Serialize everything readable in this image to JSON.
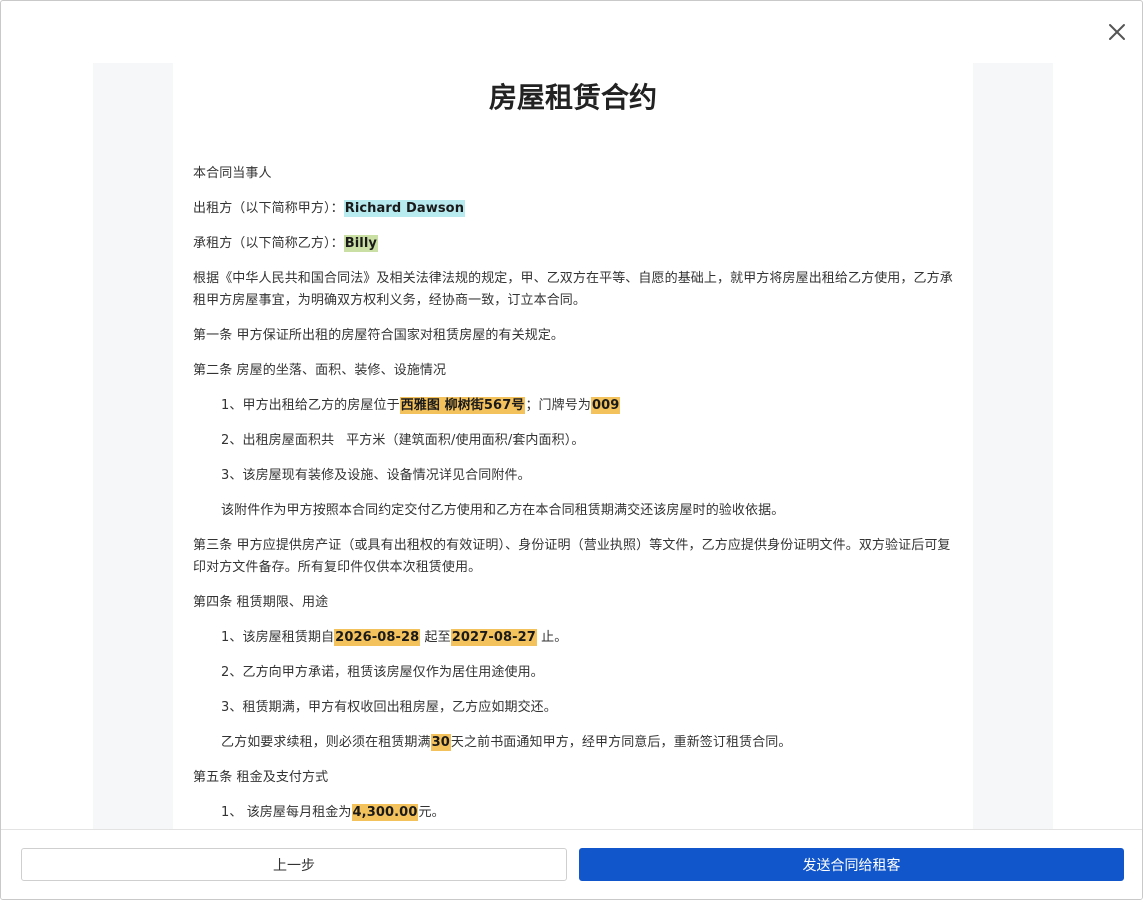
{
  "colors": {
    "primary": "#1256cc",
    "highlight_landlord": "#b8ebf0",
    "highlight_tenant": "#c9dfa3",
    "highlight_field": "#f4c25c",
    "doc_background": "#f6f7f9"
  },
  "icons": {
    "close": "close-icon"
  },
  "document": {
    "title": "房屋租赁合约",
    "parties_heading": "本合同当事人",
    "landlord_label": "出租方（以下简称甲方）：",
    "landlord_name": "Richard Dawson",
    "tenant_label": "承租方（以下简称乙方）：",
    "tenant_name": "Billy",
    "preamble": "根据《中华人民共和国合同法》及相关法律法规的规定，甲、乙双方在平等、自愿的基础上，就甲方将房屋出租给乙方使用，乙方承租甲方房屋事宜，为明确双方权利义务，经协商一致，订立本合同。",
    "article1": "第一条 甲方保证所出租的房屋符合国家对租赁房屋的有关规定。",
    "article2": {
      "heading": "第二条 房屋的坐落、面积、装修、设施情况",
      "item1_prefix": "1、甲方出租给乙方的房屋位于",
      "address": "西雅图 柳树街567号",
      "item1_mid": "；门牌号为",
      "door_number": "009",
      "item2_prefix": "2、出租房屋面积共",
      "item2_suffix": "平方米（建筑面积/使用面积/套内面积）。",
      "item3": "3、该房屋现有装修及设施、设备情况详见合同附件。",
      "note": "该附件作为甲方按照本合同约定交付乙方使用和乙方在本合同租赁期满交还该房屋时的验收依据。"
    },
    "article3": "第三条 甲方应提供房产证（或具有出租权的有效证明）、身份证明（营业执照）等文件，乙方应提供身份证明文件。双方验证后可复印对方文件备存。所有复印件仅供本次租赁使用。",
    "article4": {
      "heading": "第四条 租赁期限、用途",
      "item1_prefix": "1、该房屋租赁期自",
      "start_date": "2026-08-28",
      "item1_mid": " 起至",
      "end_date": "2027-08-27",
      "item1_suffix": " 止。",
      "item2": "2、乙方向甲方承诺，租赁该房屋仅作为居住用途使用。",
      "item3": "3、租赁期满，甲方有权收回出租房屋，乙方应如期交还。",
      "renewal_prefix": "乙方如要求续租，则必须在租赁期满",
      "renewal_days": "30",
      "renewal_suffix": "天之前书面通知甲方，经甲方同意后，重新签订租赁合同。"
    },
    "article5": {
      "heading": "第五条 租金及支付方式",
      "item1_prefix": "1、 该房屋每月租金为",
      "rent": "4,300.00",
      "item1_suffix": "元。"
    }
  },
  "footer": {
    "prev_label": "上一步",
    "send_label": "发送合同给租客"
  }
}
